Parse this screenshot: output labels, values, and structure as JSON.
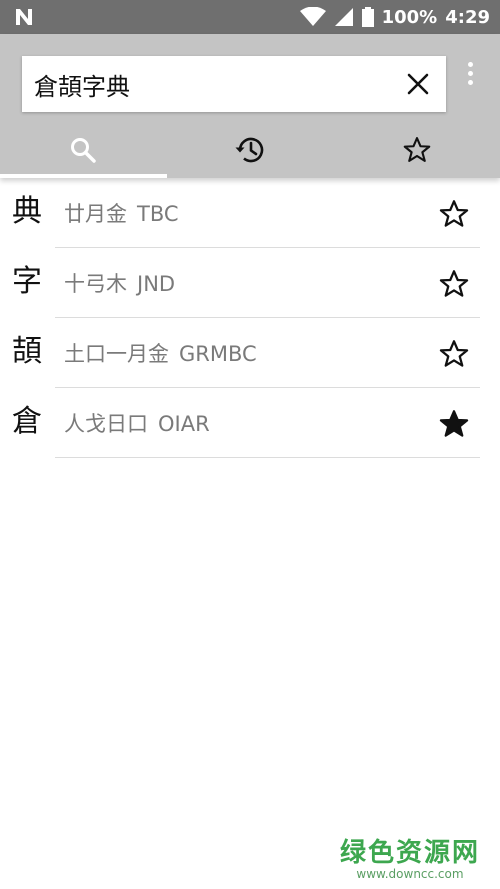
{
  "status_bar": {
    "battery": "100%",
    "time": "4:29"
  },
  "search": {
    "value": "倉頡字典",
    "placeholder": ""
  },
  "tabs": [
    {
      "icon": "search-icon",
      "active": true
    },
    {
      "icon": "history-icon",
      "active": false
    },
    {
      "icon": "star-outline-icon",
      "active": false
    }
  ],
  "entries": [
    {
      "char": "典",
      "code_cn": "廿月金",
      "code_latin": "TBC",
      "favorite": false
    },
    {
      "char": "字",
      "code_cn": "十弓木",
      "code_latin": "JND",
      "favorite": false
    },
    {
      "char": "頡",
      "code_cn": "土口一月金",
      "code_latin": "GRMBC",
      "favorite": false
    },
    {
      "char": "倉",
      "code_cn": "人戈日口",
      "code_latin": "OIAR",
      "favorite": true
    }
  ],
  "watermark": {
    "title": "绿色资源网",
    "url": "www.downcc.com"
  },
  "colors": {
    "status_bar": "#6f6f6f",
    "toolbar": "#c4c4c4",
    "tab_indicator": "#ffffff",
    "code_text": "#7a7a7a",
    "watermark": "#3da74f"
  }
}
